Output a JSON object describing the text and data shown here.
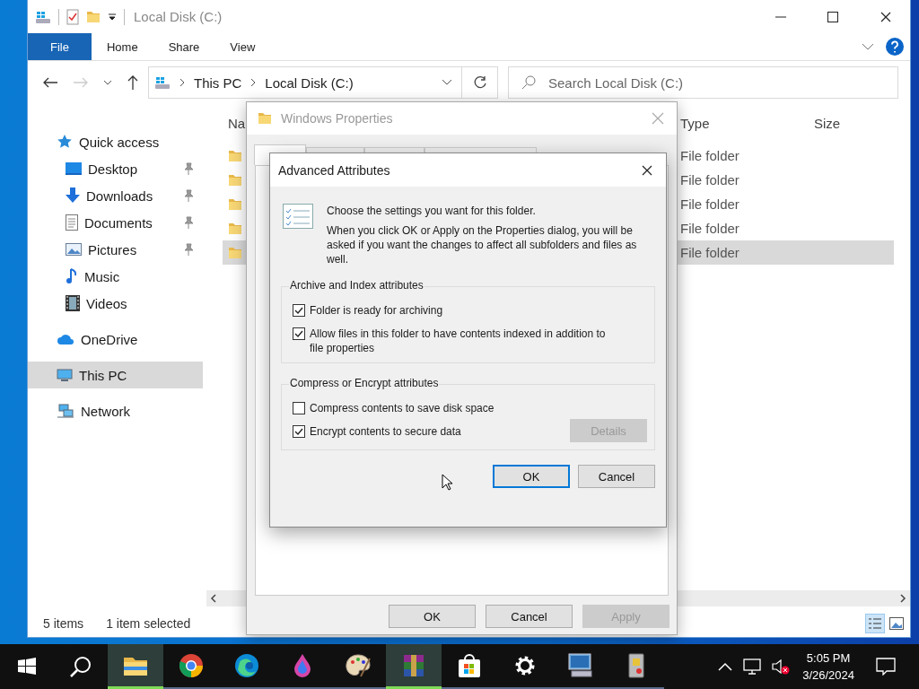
{
  "explorer": {
    "title": "Local Disk (C:)",
    "ribbon_tabs": [
      {
        "label": "File",
        "selected": true
      },
      {
        "label": "Home",
        "selected": false
      },
      {
        "label": "Share",
        "selected": false
      },
      {
        "label": "View",
        "selected": false
      }
    ],
    "address": [
      "This PC",
      "Local Disk (C:)"
    ],
    "search": {
      "placeholder": "Search Local Disk (C:)"
    },
    "nav": [
      {
        "label": "Quick access",
        "kind": "star",
        "selected": false,
        "children": [
          {
            "label": "Desktop",
            "kind": "desktop",
            "pinned": true,
            "selected": false
          },
          {
            "label": "Downloads",
            "kind": "download",
            "pinned": true,
            "selected": false
          },
          {
            "label": "Documents",
            "kind": "documents",
            "pinned": true,
            "selected": false
          },
          {
            "label": "Pictures",
            "kind": "pictures",
            "pinned": true,
            "selected": false
          },
          {
            "label": "Music",
            "kind": "music",
            "pinned": false,
            "selected": false
          },
          {
            "label": "Videos",
            "kind": "videos",
            "pinned": false,
            "selected": false
          }
        ]
      },
      {
        "label": "OneDrive",
        "kind": "cloud",
        "selected": false
      },
      {
        "label": "This PC",
        "kind": "pc",
        "selected": true
      },
      {
        "label": "Network",
        "kind": "network",
        "selected": false
      }
    ],
    "columns": [
      "Na",
      "Type",
      "Size"
    ],
    "rows": [
      {
        "type": "File folder",
        "selected": false
      },
      {
        "type": "File folder",
        "selected": false
      },
      {
        "type": "File folder",
        "selected": false
      },
      {
        "type": "File folder",
        "selected": false
      },
      {
        "type": "File folder",
        "selected": true
      }
    ],
    "status": [
      "5 items",
      "1 item selected"
    ]
  },
  "properties": {
    "title": "Windows Properties",
    "tabs": [
      {
        "selected": true
      },
      {
        "selected": false
      },
      {
        "selected": false
      },
      {
        "selected": false
      }
    ],
    "buttons": [
      {
        "label": "OK",
        "disabled": false
      },
      {
        "label": "Cancel",
        "disabled": false
      },
      {
        "label": "Apply",
        "disabled": true
      }
    ]
  },
  "advanced": {
    "title": "Advanced Attributes",
    "intro": "Choose the settings you want for this folder.",
    "note": "When you click OK or Apply on the Properties dialog, you will be asked if you want the changes to affect all subfolders and files as well.",
    "groups": [
      {
        "title": "Archive and Index attributes",
        "options": [
          {
            "label": "Folder is ready for archiving",
            "checked": true
          },
          {
            "label": "Allow files in this folder to have contents indexed in addition to file properties",
            "checked": true
          }
        ]
      },
      {
        "title": "Compress or Encrypt attributes",
        "options": [
          {
            "label": "Compress contents to save disk space",
            "checked": false
          },
          {
            "label": "Encrypt contents to secure data",
            "checked": true,
            "button": {
              "label": "Details",
              "disabled": true
            }
          }
        ]
      }
    ],
    "buttons": [
      {
        "label": "OK",
        "default": true
      },
      {
        "label": "Cancel",
        "default": false
      }
    ]
  },
  "taskbar": {
    "apps": [
      {
        "kind": "explorer",
        "active": true
      },
      {
        "kind": "chrome",
        "active": false
      },
      {
        "kind": "edge",
        "active": false
      },
      {
        "kind": "drop",
        "active": false
      },
      {
        "kind": "palette",
        "active": false
      },
      {
        "kind": "archive",
        "active": true
      },
      {
        "kind": "store",
        "active": false
      },
      {
        "kind": "settings",
        "active": false
      },
      {
        "kind": "computer",
        "active": false
      },
      {
        "kind": "device",
        "active": false
      }
    ],
    "time": "5:05 PM",
    "date": "3/26/2024"
  }
}
